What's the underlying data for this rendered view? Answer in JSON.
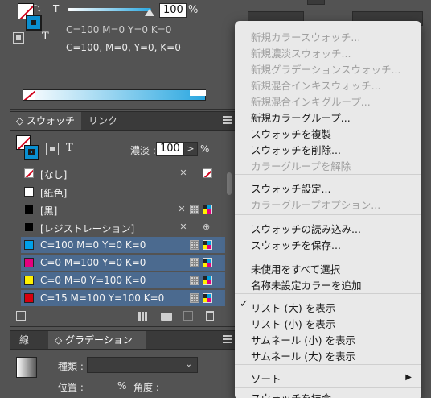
{
  "color_panel": {
    "tint_symbol": "T",
    "tint_value": "100",
    "percent": "%",
    "cmyk_line1": "C=100 M=0 Y=0 K=0",
    "cmyk_line2": "C=100, M=0, Y=0, K=0",
    "accent": "#2aa7e0"
  },
  "swatches_panel": {
    "tabs": [
      {
        "label": "◇ スウォッチ",
        "active": true
      },
      {
        "label": "リンク",
        "active": false
      }
    ],
    "tint_label": "濃淡 :",
    "tint_value": "100",
    "percent": "%",
    "arrow": ">",
    "items": [
      {
        "name": "[なし]",
        "chip": "none",
        "selected": false
      },
      {
        "name": "[紙色]",
        "chip": "#ffffff",
        "selected": false
      },
      {
        "name": "[黒]",
        "chip": "#000000",
        "selected": false
      },
      {
        "name": "[レジストレーション]",
        "chip": "#000000",
        "selected": false
      },
      {
        "name": "C=100 M=0 Y=0 K=0",
        "chip": "#00a0e9",
        "selected": true
      },
      {
        "name": "C=0 M=100 Y=0 K=0",
        "chip": "#e4007f",
        "selected": true
      },
      {
        "name": "C=0 M=0 Y=100 K=0",
        "chip": "#fff100",
        "selected": true
      },
      {
        "name": "C=15 M=100 Y=100 K=0",
        "chip": "#d7000f",
        "selected": true
      }
    ]
  },
  "gradient_panel": {
    "tabs": [
      {
        "label": "線",
        "active": false
      },
      {
        "label": "◇ グラデーション",
        "active": true
      }
    ],
    "type_label": "種類 :",
    "position_label": "位置 :",
    "percent": "%",
    "angle_label": "角度 :"
  },
  "context_menu": {
    "items": [
      {
        "label": "新規カラースウォッチ...",
        "disabled": true
      },
      {
        "label": "新規濃淡スウォッチ...",
        "disabled": true
      },
      {
        "label": "新規グラデーションスウォッチ...",
        "disabled": true
      },
      {
        "label": "新規混合インキスウォッチ...",
        "disabled": true
      },
      {
        "label": "新規混合インキグループ...",
        "disabled": true
      },
      {
        "label": "新規カラーグループ...",
        "disabled": false
      },
      {
        "label": "スウォッチを複製",
        "disabled": false
      },
      {
        "label": "スウォッチを削除...",
        "disabled": false
      },
      {
        "label": "カラーグループを解除",
        "disabled": true
      },
      {
        "label": "スウォッチ設定...",
        "disabled": false
      },
      {
        "label": "カラーグループオプション...",
        "disabled": true
      },
      {
        "label": "スウォッチの読み込み...",
        "disabled": false
      },
      {
        "label": "スウォッチを保存...",
        "disabled": false
      },
      {
        "label": "未使用をすべて選択",
        "disabled": false
      },
      {
        "label": "名称未設定カラーを追加",
        "disabled": false
      },
      {
        "label": "リスト (大) を表示",
        "disabled": false,
        "checked": true
      },
      {
        "label": "リスト (小) を表示",
        "disabled": false
      },
      {
        "label": "サムネール (小) を表示",
        "disabled": false
      },
      {
        "label": "サムネール (大) を表示",
        "disabled": false
      },
      {
        "label": "ソート",
        "disabled": false,
        "submenu": true
      },
      {
        "label": "スウォッチを結合",
        "disabled": false
      }
    ],
    "check_glyph": "✓",
    "submenu_glyph": "▶"
  }
}
